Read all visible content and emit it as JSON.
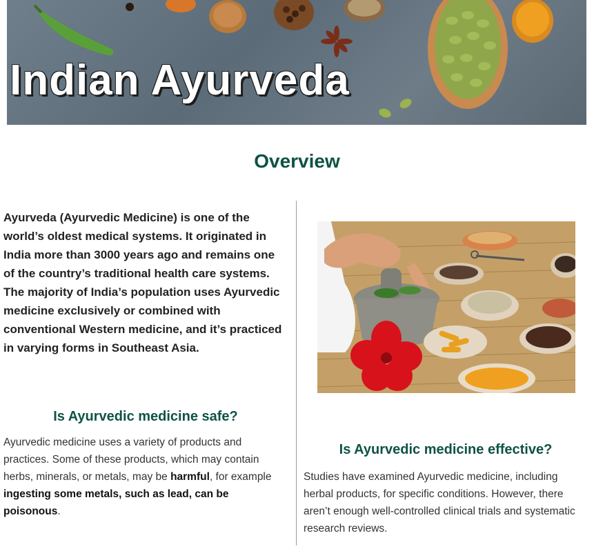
{
  "banner": {
    "title": "Indian Ayurveda"
  },
  "overview": {
    "heading": "Overview"
  },
  "intro": {
    "text": "Ayurveda (Ayurvedic Medicine) is one of the world’s oldest medical systems. It originated in India more than 3000 years ago and remains one of the country’s traditional health care systems. The majority of India’s population uses Ayurvedic medicine exclusively or combined with conventional Western medicine, and it’s practiced in varying forms in Southeast Asia."
  },
  "safety": {
    "heading": "Is Ayurvedic medicine safe?",
    "text_1": "Ayurvedic medicine uses a variety of products and practices. Some of these products, which may contain herbs, minerals, or metals, may be ",
    "bold_1": "harmful",
    "text_2": ", for example ",
    "bold_2": "ingesting some metals, such as lead, can be poisonous",
    "text_3": "."
  },
  "effectiveness": {
    "heading": "Is Ayurvedic medicine effective?",
    "text": "Studies have examined Ayurvedic medicine, including herbal products, for specific conditions. However, there aren’t enough well-controlled clinical trials and systematic research reviews."
  },
  "colors": {
    "heading_green": "#0e5246",
    "banner_slate": "#6f7f8c"
  }
}
